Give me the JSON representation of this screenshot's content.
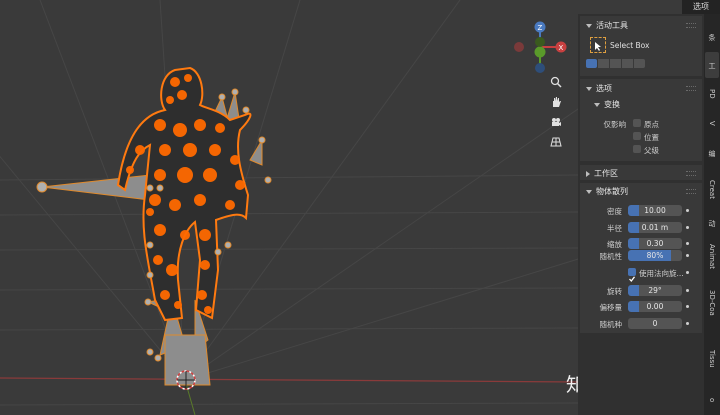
{
  "header": {
    "options_label": "选项"
  },
  "viewport": {
    "watermark": "知乎 @杨硕豪"
  },
  "tabs": [
    "条",
    "工",
    "PD",
    "V",
    "编",
    "Creat",
    "动",
    "Animat",
    "3D-Coa",
    "Tissu",
    "o"
  ],
  "active_tool": {
    "title": "活动工具",
    "tool_name": "Select Box"
  },
  "options": {
    "title": "选项",
    "transform_title": "变换",
    "affect_only_label": "仅影响",
    "checkboxes": [
      "原点",
      "位置",
      "父级"
    ]
  },
  "workspace": {
    "title": "工作区"
  },
  "scatter": {
    "title": "物体散列",
    "fields": [
      {
        "label": "密度",
        "value": "10.00",
        "fill": 0.2
      },
      {
        "label": "半径",
        "value": "0.01 m",
        "fill": 0.2
      },
      {
        "label": "缩放",
        "value": "0.30",
        "fill": 0.2
      },
      {
        "label": "随机性",
        "value": "80%",
        "fill": 0.8
      }
    ],
    "use_normal_label": "使用法向旋...",
    "fields2": [
      {
        "label": "旋转",
        "value": "29°",
        "fill": 0.2
      },
      {
        "label": "偏移量",
        "value": "0.00",
        "fill": 0.2
      },
      {
        "label": "随机种",
        "value": "0",
        "fill": 0
      }
    ]
  }
}
